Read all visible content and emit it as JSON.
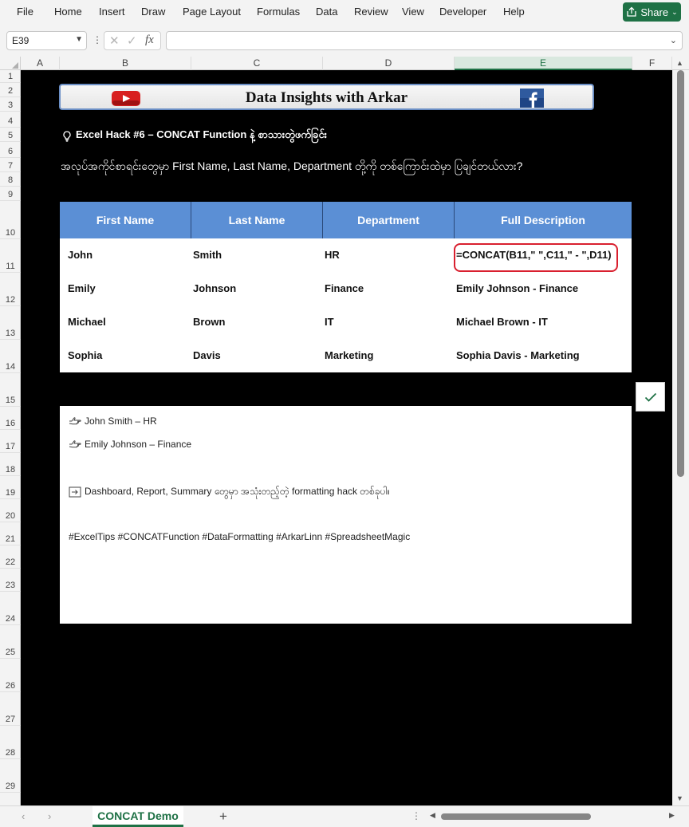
{
  "menu": {
    "items": [
      "File",
      "Home",
      "Insert",
      "Draw",
      "Page Layout",
      "Formulas",
      "Data",
      "Review",
      "View",
      "Developer",
      "Help"
    ],
    "share_label": "Share"
  },
  "formula_bar": {
    "name_box": "E39",
    "fx_label": "fx",
    "formula": ""
  },
  "columns": [
    "A",
    "B",
    "C",
    "D",
    "E",
    "F"
  ],
  "selected_column": "E",
  "rows": [
    "1",
    "2",
    "3",
    "4",
    "5",
    "6",
    "7",
    "8",
    "9",
    "10",
    "11",
    "12",
    "13",
    "14",
    "15",
    "16",
    "17",
    "18",
    "19",
    "20",
    "21",
    "22",
    "23",
    "24",
    "25",
    "26",
    "27",
    "28",
    "29"
  ],
  "sheet": {
    "banner_title": "Data Insights with Arkar",
    "hack_title": "Excel Hack #6 – CONCAT Function နဲ့ စာသားတွဲဖက်ခြင်း",
    "question": "အလုပ်အကိုင်စာရင်းတွေမှာ First Name, Last Name, Department တို့ကို တစ်ကြောင်းထဲမှာ ပြချင်တယ်လား?",
    "table": {
      "headers": [
        "First Name",
        "Last Name",
        "Department",
        "Full Description"
      ],
      "rows": [
        [
          "John",
          "Smith",
          "HR",
          "=CONCAT(B11,\" \",C11,\" - \",D11)"
        ],
        [
          "Emily",
          "Johnson",
          "Finance",
          "Emily Johnson - Finance"
        ],
        [
          "Michael",
          "Brown",
          "IT",
          "Michael Brown - IT"
        ],
        [
          "Sophia",
          "Davis",
          "Marketing",
          "Sophia Davis - Marketing"
        ]
      ]
    },
    "notes": {
      "example1": "John Smith – HR",
      "example2": "Emily Johnson – Finance",
      "tip": "Dashboard, Report, Summary တွေမှာ အသုံးတည့်တဲ့ formatting hack တစ်ခုပါ။",
      "hashtags": "#ExcelTips #CONCATFunction #DataFormatting #ArkarLinn #SpreadsheetMagic"
    }
  },
  "tabs": {
    "active": "CONCAT Demo",
    "add_label": "+"
  },
  "colors": {
    "excel_green": "#1e7145",
    "header_blue": "#5b8fd5",
    "highlight_red": "#d9202f"
  }
}
